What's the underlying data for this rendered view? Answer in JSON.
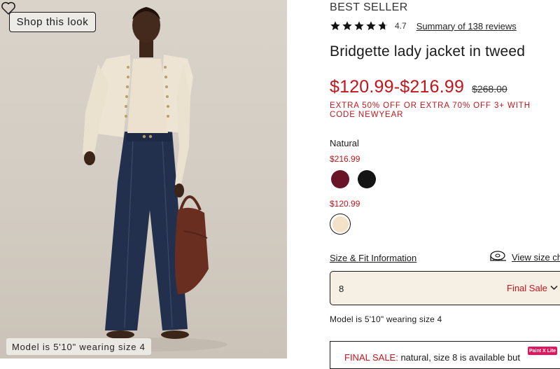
{
  "image_panel": {
    "shop_button_label": "Shop this look",
    "model_caption": "Model is 5'10\" wearing size 4"
  },
  "product": {
    "badge": "BEST SELLER",
    "rating": {
      "value": "4.7",
      "stars": 4.7,
      "reviews_link": "Summary of 138 reviews"
    },
    "title": "Bridgette lady jacket in tweed",
    "price_range": "$120.99-$216.99",
    "original_price": "$268.00",
    "promo": "EXTRA 50% OFF OR EXTRA 70% OFF 3+ WITH CODE NEWYEAR",
    "color_label": "Natural",
    "swatch_groups": [
      {
        "price": "$216.99",
        "swatches": [
          {
            "color": "#6a1428"
          },
          {
            "color": "#141414"
          }
        ]
      },
      {
        "price": "$120.99",
        "swatches": [
          {
            "color": "#f3e2c8",
            "selected": true
          }
        ]
      }
    ],
    "size_info_link": "Size & Fit Information",
    "size_chart_link": "View size chart",
    "size_select": {
      "value": "8",
      "status": "Final Sale"
    },
    "model_note": "Model is 5'10\" wearing size 4",
    "notice": {
      "highlight": "FINAL SALE:",
      "text": " natural, size 8 is available but"
    }
  },
  "extension_badge": "Paint X Lite",
  "colors": {
    "sale_red": "#c4151c",
    "selected_swatch_bg": "#f6efe4"
  }
}
